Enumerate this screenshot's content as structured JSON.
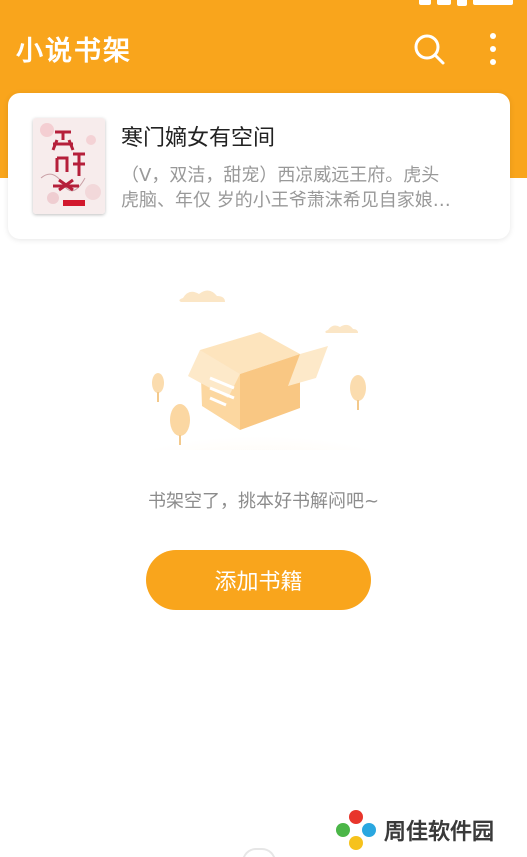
{
  "app": {
    "title": "小说书架"
  },
  "colors": {
    "accent": "#f9a51c",
    "text_primary": "#222222",
    "text_secondary": "#999999",
    "empty_text": "#8c8c8c"
  },
  "toolbar": {
    "search_icon": "search-icon",
    "more_icon": "more-vertical-icon"
  },
  "shelf": {
    "books": [
      {
        "title": "寒门嫡女有空间",
        "description": "（V，双洁，甜宠）西凉威远王府。虎头\n虎脑、年仅 岁的小王爷萧沫希见自家娘…"
      }
    ]
  },
  "empty_state": {
    "message": "书架空了，挑本好书解闷吧~",
    "add_button_label": "添加书籍"
  },
  "watermark": {
    "text": "周佳软件园"
  }
}
